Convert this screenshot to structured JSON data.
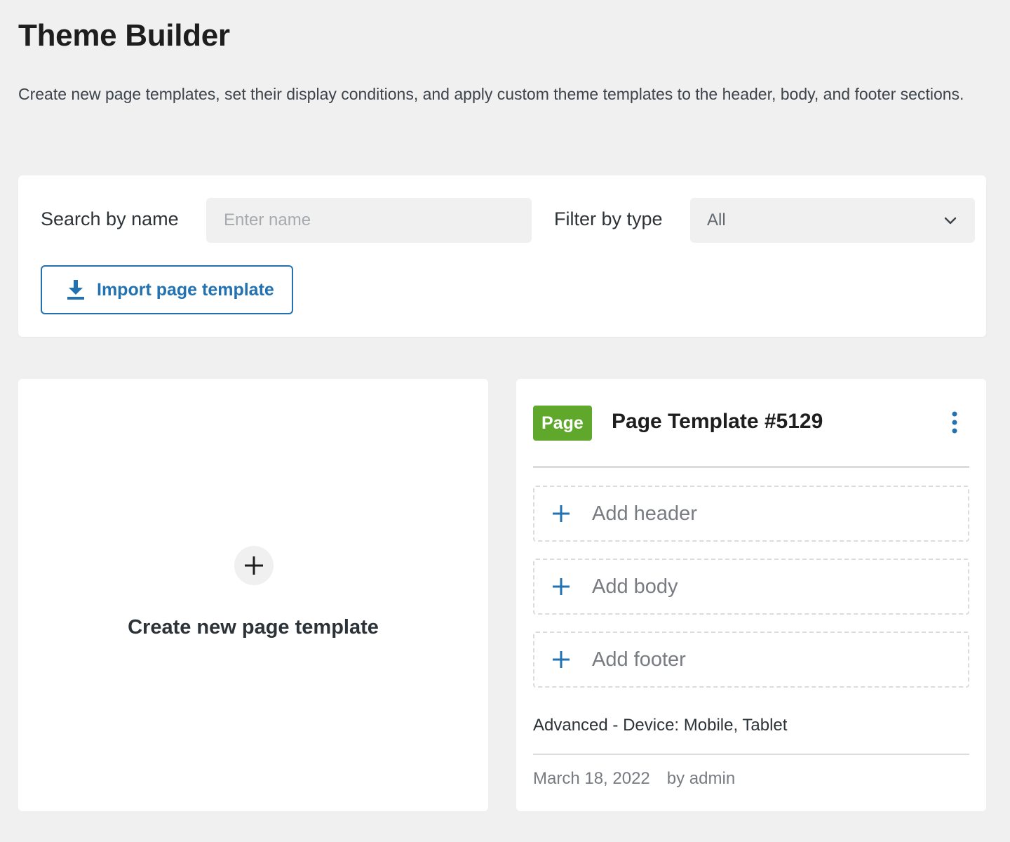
{
  "page": {
    "title": "Theme Builder",
    "description": "Create new page templates, set their display conditions, and apply custom theme templates to the header, body, and footer sections."
  },
  "toolbar": {
    "search_label": "Search by name",
    "search_placeholder": "Enter name",
    "search_value": "",
    "filter_label": "Filter by type",
    "filter_value": "All",
    "import_label": "Import page template"
  },
  "create_card": {
    "label": "Create new page template"
  },
  "template_card": {
    "badge": "Page",
    "title": "Page Template #5129",
    "slots": {
      "header": "Add header",
      "body": "Add body",
      "footer": "Add footer"
    },
    "conditions": "Advanced - Device: Mobile, Tablet",
    "date": "March 18, 2022",
    "author": "by admin"
  },
  "icons": {
    "download": "download-icon",
    "chevron": "chevron-down-icon",
    "plus": "plus-icon",
    "kebab": "kebab-menu-icon"
  },
  "colors": {
    "accent": "#2271b1",
    "badge": "#5fa82b",
    "background": "#f0f0f1",
    "card": "#ffffff"
  }
}
